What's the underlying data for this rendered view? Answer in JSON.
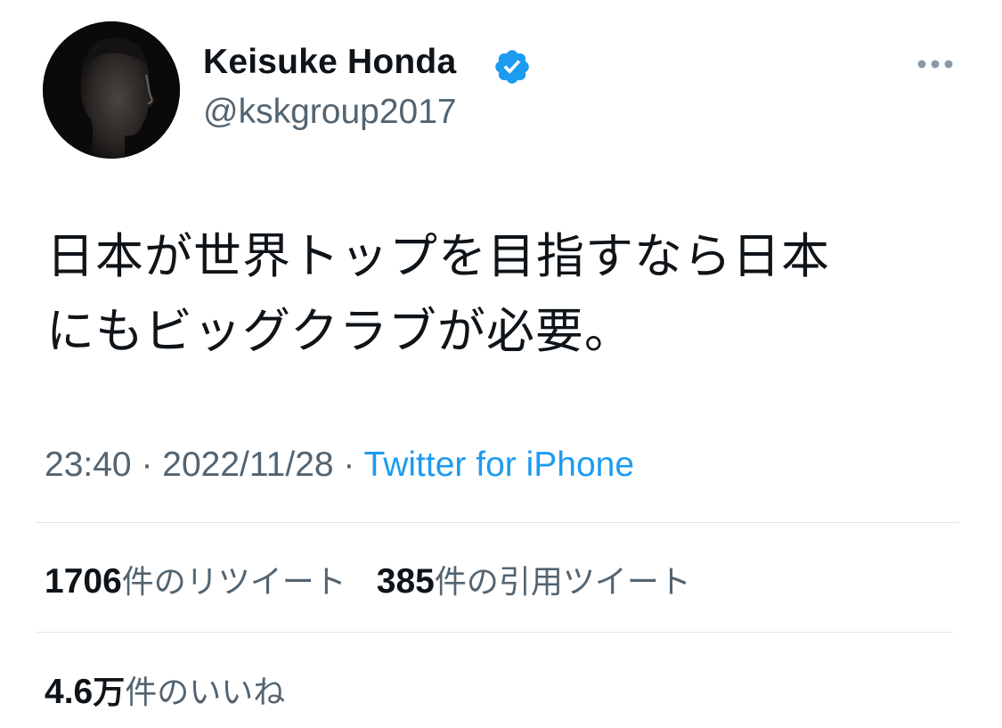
{
  "author": {
    "display_name": "Keisuke Honda",
    "handle": "@kskgroup2017",
    "verified": true,
    "avatar_icon": "profile-photo-avatar"
  },
  "menu": {
    "more_icon": "more-horizontal-icon"
  },
  "tweet": {
    "text_line1": "日本が世界トップを目指すなら日本",
    "text_line2": "にもビッグクラブが必要。"
  },
  "meta": {
    "time": "23:40",
    "separator": "·",
    "date": "2022/11/28",
    "source": "Twitter for iPhone"
  },
  "stats": {
    "retweets_count": "1706",
    "retweets_label": "件のリツイート",
    "quotes_count": "385",
    "quotes_label": "件の引用ツイート",
    "likes_count": "4.6",
    "likes_unit": "万",
    "likes_label": "件のいいね"
  },
  "colors": {
    "text_primary": "#0f1419",
    "text_secondary": "#536471",
    "link": "#1d9bf0",
    "verified_badge": "#1d9bf0",
    "divider": "#e1e6ea"
  }
}
